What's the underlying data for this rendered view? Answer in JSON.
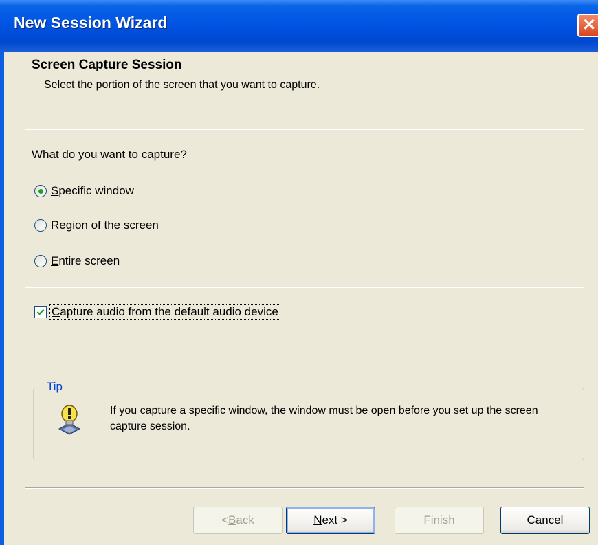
{
  "window": {
    "title": "New Session Wizard",
    "close_glyph": "✕"
  },
  "header": {
    "title": "Screen Capture Session",
    "subtitle": "Select the portion of the screen that you want to capture."
  },
  "capture": {
    "question": "What do you want to capture?",
    "options": [
      {
        "mnemonic": "S",
        "rest": "pecific window",
        "selected": true
      },
      {
        "mnemonic": "R",
        "rest": "egion of the screen",
        "selected": false
      },
      {
        "mnemonic": "E",
        "rest": "ntire screen",
        "selected": false
      }
    ]
  },
  "audio": {
    "mnemonic": "C",
    "rest": "apture audio from the default audio device",
    "checked": true
  },
  "tip": {
    "legend": "Tip",
    "text": "If you capture a specific window, the window must be open before you set up the screen capture session.",
    "icon": "lightbulb-icon"
  },
  "buttons": {
    "back": {
      "prefix": "< ",
      "mnemonic": "B",
      "rest": "ack",
      "enabled": false
    },
    "next": {
      "mnemonic": "N",
      "rest": "ext >",
      "enabled": true
    },
    "finish": {
      "label": "Finish",
      "enabled": false
    },
    "cancel": {
      "label": "Cancel",
      "enabled": true
    }
  },
  "colors": {
    "titlebar": "#0054e3",
    "face": "#ece9d8",
    "radio_dot": "#21a121",
    "tip_legend": "#0046d5"
  }
}
